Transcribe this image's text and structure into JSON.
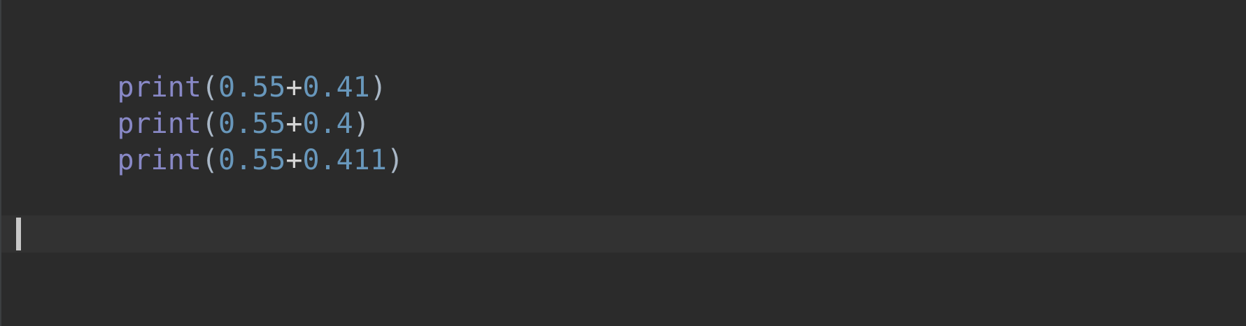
{
  "editor": {
    "lines": [
      {
        "func": "print",
        "open": "(",
        "a": "0.55",
        "op": "+",
        "b": "0.41",
        "close": ")"
      },
      {
        "func": "print",
        "open": "(",
        "a": "0.55",
        "op": "+",
        "b": "0.4",
        "close": ")"
      },
      {
        "func": "print",
        "open": "(",
        "a": "0.55",
        "op": "+",
        "b": "0.411",
        "close": ")"
      }
    ],
    "colors": {
      "background": "#2b2b2b",
      "builtin": "#8888c6",
      "number": "#6897bb",
      "text": "#a9b7c6",
      "current_line": "#323232",
      "caret": "#c8c8c8"
    }
  }
}
